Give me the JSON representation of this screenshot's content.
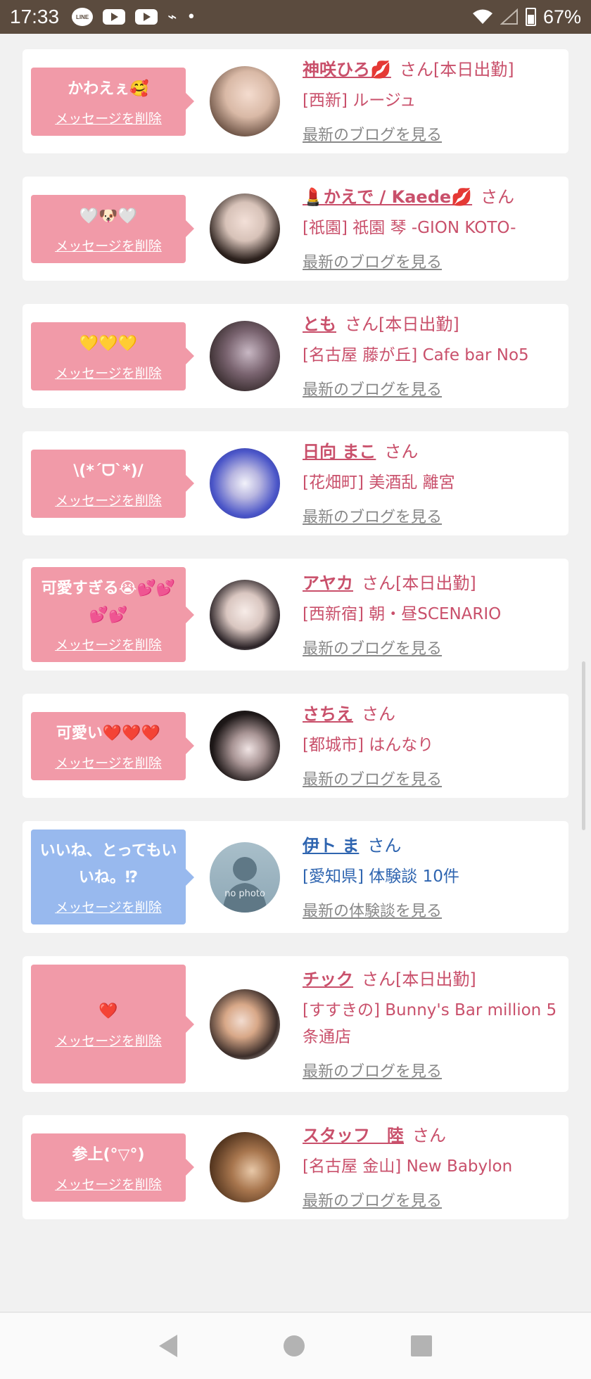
{
  "status_bar": {
    "time": "17:33",
    "line_label": "LINE",
    "misc_icon": "🖹",
    "dot": "•",
    "battery": "67%"
  },
  "delete_label": "メッセージを削除",
  "san": "さん",
  "cards": [
    {
      "message": "かわえぇ🥰",
      "name": "神咲ひろ💋",
      "suffix": "[本日出勤]",
      "shop": "[西新] ルージュ",
      "link": "最新のブログを見る"
    },
    {
      "message": "🤍🐶🤍",
      "name": "💄かえで / Kaede💋",
      "suffix": "",
      "shop": "[祇園] 祇園 琴 -GION KOTO-",
      "link": "最新のブログを見る"
    },
    {
      "message": "💛💛💛",
      "name": "とも",
      "suffix": "[本日出勤]",
      "shop": "[名古屋 藤が丘] Cafe bar No5",
      "link": "最新のブログを見る"
    },
    {
      "message": "\\(*´ᗜ`*)/",
      "name": "日向 まこ",
      "suffix": "",
      "shop": "[花畑町] 美酒乱 離宮",
      "link": "最新のブログを見る"
    },
    {
      "message": "可愛すぎる😭💕💕💕💕",
      "name": "アヤカ",
      "suffix": "[本日出勤]",
      "shop": "[西新宿] 朝・昼SCENARIO",
      "link": "最新のブログを見る"
    },
    {
      "message": "可愛い❤️❤️❤️",
      "name": "さちえ",
      "suffix": "",
      "shop": "[都城市] はんなり",
      "link": "最新のブログを見る"
    },
    {
      "message": "いいね、とってもいいね。⁉",
      "name": "伊ト ま",
      "suffix": "",
      "shop": "[愛知県] 体験談 10件",
      "link": "最新の体験談を見る",
      "avatar_text": "no photo"
    },
    {
      "message": "❤️",
      "name": "チック",
      "suffix": "[本日出勤]",
      "shop": "[すすきの] Bunny's Bar million 5条通店",
      "link": "最新のブログを見る"
    },
    {
      "message": "参上(°▽°)",
      "name": "スタッフ　陸",
      "suffix": "",
      "shop": "[名古屋 金山] New Babylon",
      "link": "最新のブログを見る"
    }
  ],
  "colors": {
    "pink_bubble": "#f19aa8",
    "blue_bubble": "#98b9ee",
    "pink_text": "#c9506b",
    "blue_text": "#2f65b0",
    "status_bar": "#5b4b3e"
  }
}
